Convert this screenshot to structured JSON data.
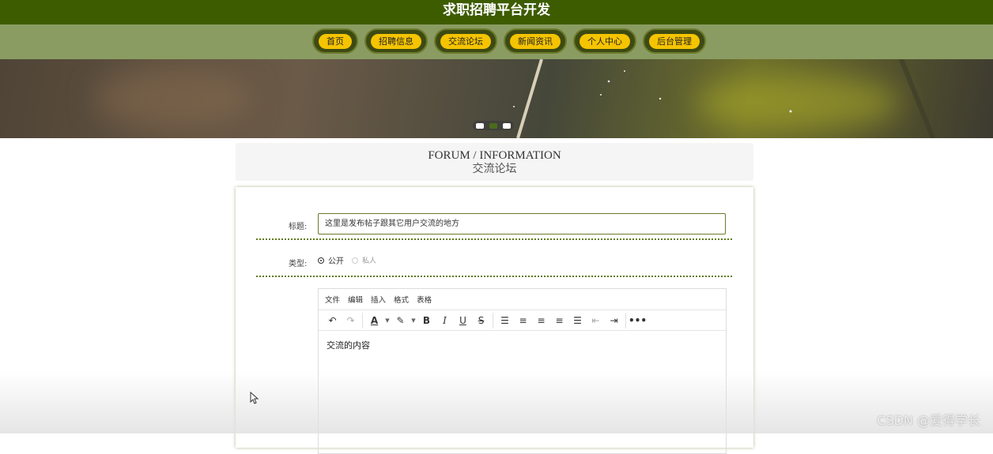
{
  "header": {
    "title": "求职招聘平台开发"
  },
  "nav": {
    "items": [
      "首页",
      "招聘信息",
      "交流论坛",
      "新闻资讯",
      "个人中心",
      "后台管理"
    ]
  },
  "banner": {
    "slides": 3,
    "active_slide": 2
  },
  "section": {
    "title_en": "FORUM / INFORMATION",
    "title_zh": "交流论坛"
  },
  "form": {
    "title_label": "标题:",
    "title_value": "这里是发布帖子跟其它用户交流的地方",
    "type_label": "类型:",
    "type_options": [
      "公开",
      "私人"
    ],
    "type_selected": "公开"
  },
  "editor": {
    "menu": [
      "文件",
      "编辑",
      "插入",
      "格式",
      "表格"
    ],
    "content": "交流的内容"
  },
  "watermark": "CSDN @爱得学长"
}
